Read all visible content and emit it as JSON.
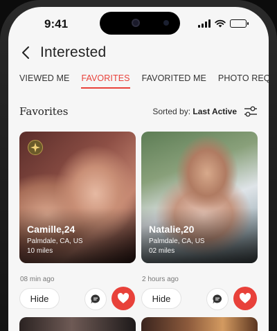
{
  "status_bar": {
    "time": "9:41"
  },
  "header": {
    "title": "Interested"
  },
  "tabs": [
    {
      "label": "VIEWED ME",
      "active": false
    },
    {
      "label": "FAVORITES",
      "active": true
    },
    {
      "label": "FAVORITED ME",
      "active": false
    },
    {
      "label": "PHOTO REQUEST",
      "active": false
    }
  ],
  "section": {
    "title": "Favorites",
    "sort_prefix": "Sorted by:",
    "sort_value": "Last Active"
  },
  "profiles": [
    {
      "name": "Camille,24",
      "location": "Palmdale, CA, US",
      "distance": "10 miles",
      "time_ago": "08 min ago",
      "badge_icon": "sparkle-icon"
    },
    {
      "name": "Natalie,20",
      "location": "Palmdale, CA, US",
      "distance": "02 miles",
      "time_ago": "2 hours ago"
    }
  ],
  "actions": {
    "hide_label": "Hide"
  },
  "colors": {
    "accent": "#e8413a",
    "background": "#f6f6f6"
  }
}
